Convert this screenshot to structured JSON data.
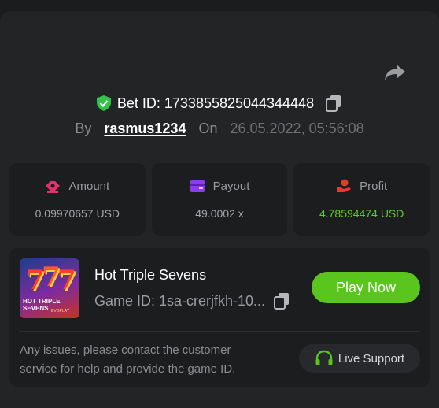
{
  "bet": {
    "id_label": "Bet ID: 1733855825044344448",
    "by_label": "By",
    "username": "rasmus1234",
    "on_label": "On",
    "datetime": "26.05.2022, 05:56:08"
  },
  "stats": {
    "amount": {
      "label": "Amount",
      "value": "0.09970657 USD",
      "icon": "amount-icon"
    },
    "payout": {
      "label": "Payout",
      "value": "49.0002 x",
      "icon": "wallet-icon"
    },
    "profit": {
      "label": "Profit",
      "value": "4.78594474 USD",
      "icon": "hand-coin-icon"
    }
  },
  "game": {
    "title": "Hot Triple Sevens",
    "id_label": "Game ID: 1sa-crerjfkh-10...",
    "play_label": "Play Now",
    "notice": "Any issues, please contact the customer service for help and provide the game ID.",
    "support_label": "Live Support",
    "thumb_text": "HOT TRIPLE SEVENS",
    "thumb_brand": "EVOPLAY"
  },
  "colors": {
    "accent_green": "#5ac51d",
    "profit_green": "#5ec92a",
    "amount_red": "#e0336b",
    "payout_purple": "#8b3cf0",
    "profit_red": "#e8382f"
  }
}
